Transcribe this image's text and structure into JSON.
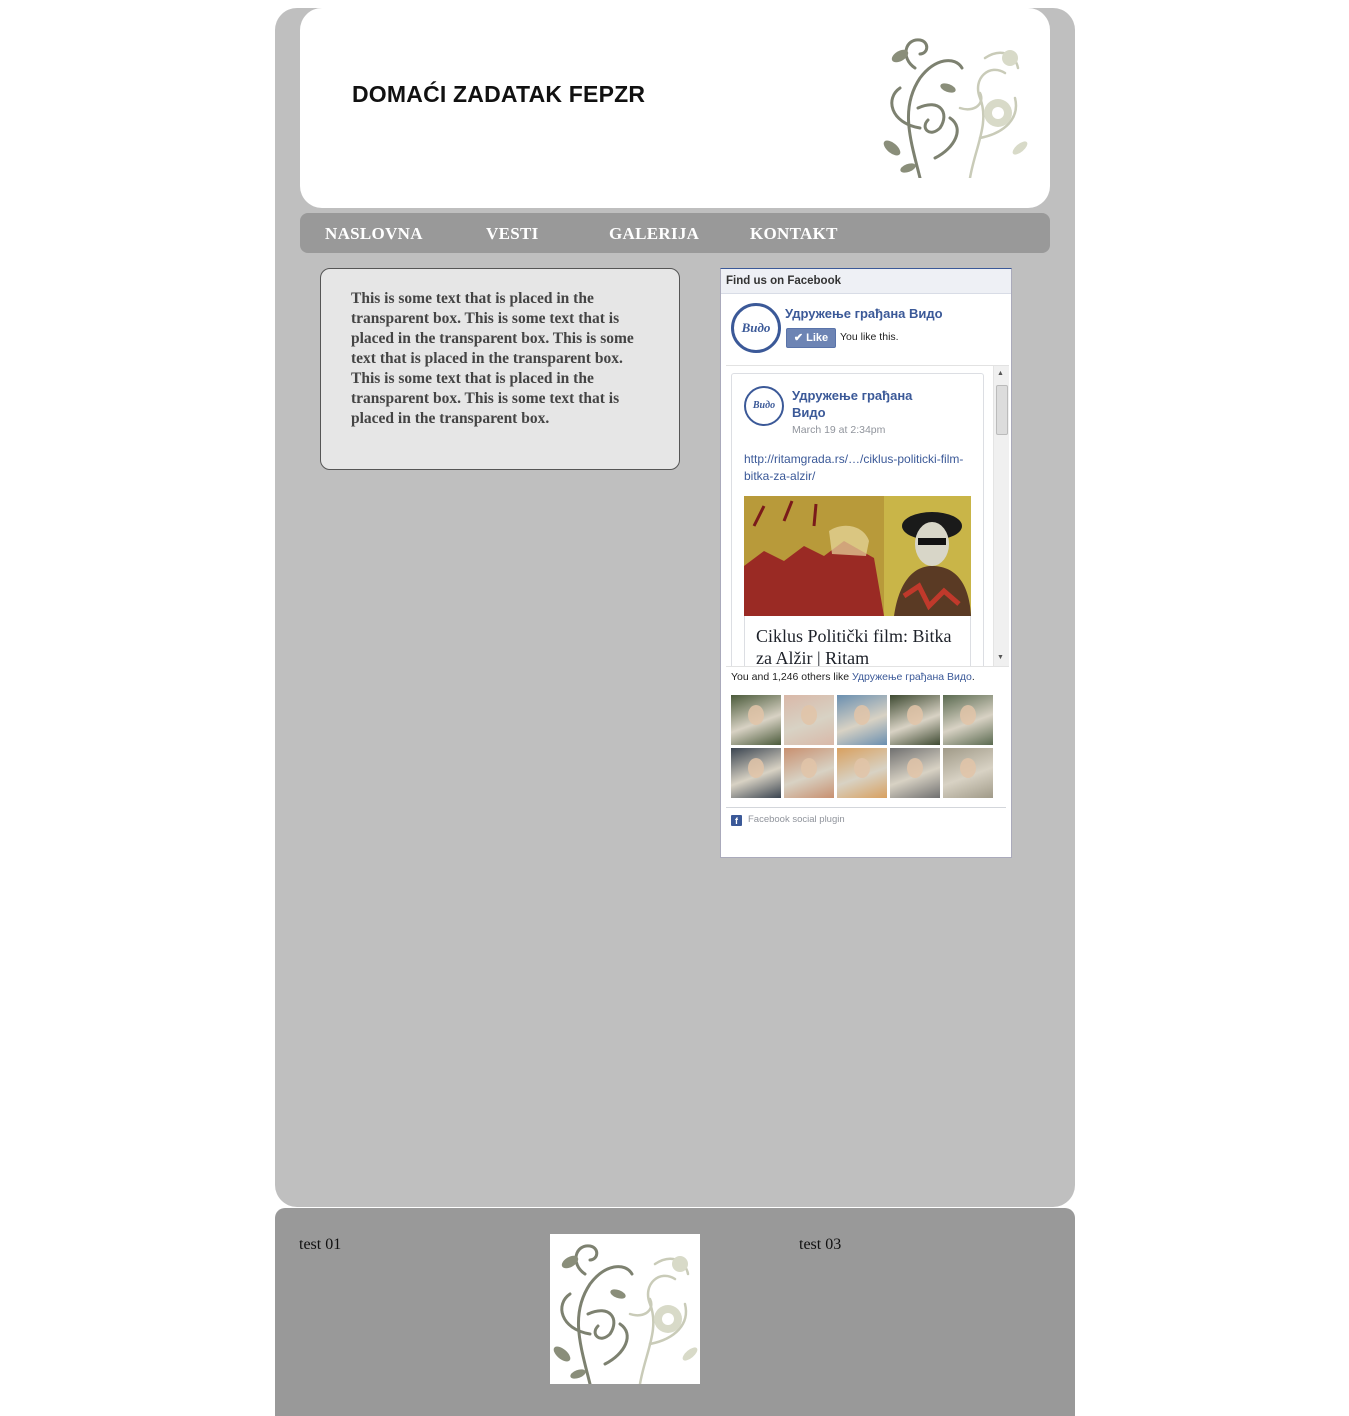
{
  "header": {
    "title": "DOMAĆI ZADATAK FEPZR",
    "ornament_icon": "floral-ornament"
  },
  "nav": {
    "items": [
      {
        "label": "NASLOVNA"
      },
      {
        "label": "VESTI"
      },
      {
        "label": "GALERIJA"
      },
      {
        "label": "KONTAKT"
      }
    ]
  },
  "content": {
    "box_text": "This is some text that is placed in the transparent box. This is some text that is placed in the transparent box. This is some text that is placed in the transparent box. This is some text that is placed in the transparent box. This is some text that is placed in the transparent box."
  },
  "facebook": {
    "heading": "Find us on Facebook",
    "page_name": "Удружење грађана Видо",
    "logo_text": "Видо",
    "like_button": "Like",
    "you_like": "You like this.",
    "post": {
      "author": "Удружење грађана Видо",
      "time": "March 19 at 2:34pm",
      "link": "http://ritamgrada.rs/…/ciklus-politicki-film-bitka-za-alzir/",
      "card_title": "Ciklus Politički film: Bitka za Alžir | Ritam"
    },
    "count_prefix": "You and 1,246 others like ",
    "count_page": "Удружење грађана Видо",
    "count_suffix": ".",
    "fans": [
      {
        "color": "#4a5a3a"
      },
      {
        "color": "#d9b8a8"
      },
      {
        "color": "#6a8fb0"
      },
      {
        "color": "#3e4a32"
      },
      {
        "color": "#5a6a50"
      },
      {
        "color": "#3a4450"
      },
      {
        "color": "#c89070"
      },
      {
        "color": "#d8a060"
      },
      {
        "color": "#707070"
      },
      {
        "color": "#a09a88"
      }
    ],
    "plugin_label": "Facebook social plugin"
  },
  "footer": {
    "col1": "test 01",
    "col3": "test 03",
    "image_icon": "floral-ornament"
  },
  "colors": {
    "page_bg": "#bfbfbf",
    "nav_bg": "#999999",
    "footer_bg": "#999999",
    "fb_blue": "#3b5998"
  }
}
